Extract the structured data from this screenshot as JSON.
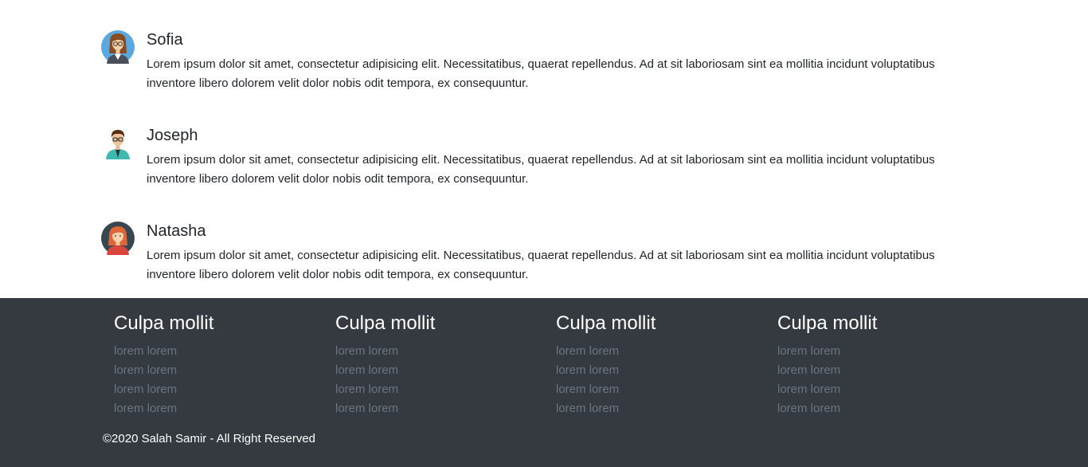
{
  "testimonials": [
    {
      "name": "Sofia",
      "text": "Lorem ipsum dolor sit amet, consectetur adipisicing elit. Necessitatibus, quaerat repellendus. Ad at sit laboriosam sint ea mollitia incidunt voluptatibus inventore libero dolorem velit dolor nobis odit tempora, ex consequuntur.",
      "avatar_icon": "woman-with-glasses-avatar-icon"
    },
    {
      "name": "Joseph",
      "text": "Lorem ipsum dolor sit amet, consectetur adipisicing elit. Necessitatibus, quaerat repellendus. Ad at sit laboriosam sint ea mollitia incidunt voluptatibus inventore libero dolorem velit dolor nobis odit tempora, ex consequuntur.",
      "avatar_icon": "man-with-glasses-avatar-icon"
    },
    {
      "name": "Natasha",
      "text": "Lorem ipsum dolor sit amet, consectetur adipisicing elit. Necessitatibus, quaerat repellendus. Ad at sit laboriosam sint ea mollitia incidunt voluptatibus inventore libero dolorem velit dolor nobis odit tempora, ex consequuntur.",
      "avatar_icon": "red-haired-woman-avatar-icon"
    }
  ],
  "footer": {
    "columns": [
      {
        "title": "Culpa mollit",
        "links": [
          "lorem lorem",
          "lorem lorem",
          "lorem lorem",
          "lorem lorem"
        ]
      },
      {
        "title": "Culpa mollit",
        "links": [
          "lorem lorem",
          "lorem lorem",
          "lorem lorem",
          "lorem lorem"
        ]
      },
      {
        "title": "Culpa mollit",
        "links": [
          "lorem lorem",
          "lorem lorem",
          "lorem lorem",
          "lorem lorem"
        ]
      },
      {
        "title": "Culpa mollit",
        "links": [
          "lorem lorem",
          "lorem lorem",
          "lorem lorem",
          "lorem lorem"
        ]
      }
    ],
    "copyright": "©2020 Salah Samir - All Right Reserved"
  },
  "colors": {
    "footer_bg": "#343a40",
    "footer_link": "#6c757d",
    "text": "#212529"
  }
}
